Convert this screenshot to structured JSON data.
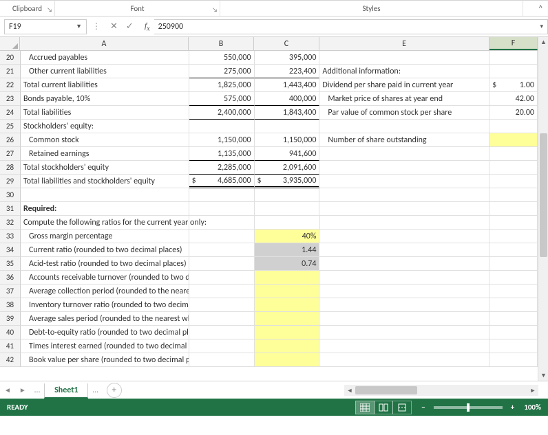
{
  "ribbon": {
    "clipboard": "Clipboard",
    "font": "Font",
    "styles": "Styles"
  },
  "namebox": {
    "ref": "F19"
  },
  "formula_bar": {
    "value": "250900"
  },
  "columns": {
    "A": "A",
    "B": "B",
    "C": "C",
    "E": "E",
    "F": "F"
  },
  "rows": [
    {
      "n": "20",
      "A": "Accrued payables",
      "Ai": 1,
      "B": "550,000",
      "C": "395,000",
      "E": "",
      "F": ""
    },
    {
      "n": "21",
      "A": "Other current liabilities",
      "Ai": 1,
      "B": "275,000",
      "Bu": 1,
      "C": "223,400",
      "Cu": 1,
      "E": "Additional information:",
      "F": ""
    },
    {
      "n": "22",
      "A": "Total current liabilities",
      "B": "1,825,000",
      "C": "1,443,400",
      "E": "Dividend per share paid in current year",
      "F": "1.00",
      "Fd": 1
    },
    {
      "n": "23",
      "A": "Bonds payable, 10%",
      "B": "575,000",
      "Bu": 1,
      "C": "400,000",
      "Cu": 1,
      "E": "Market price of shares at year end",
      "Ei": 1,
      "F": "42.00"
    },
    {
      "n": "24",
      "A": "Total liabilities",
      "B": "2,400,000",
      "Bu": 1,
      "C": "1,843,400",
      "Cu": 1,
      "E": "Par value of common stock per share",
      "Ei": 1,
      "F": "20.00"
    },
    {
      "n": "25",
      "A": "Stockholders' equity:",
      "B": "",
      "C": "",
      "E": "",
      "F": ""
    },
    {
      "n": "26",
      "A": "Common stock",
      "Ai": 1,
      "B": "1,150,000",
      "C": "1,150,000",
      "E": "Number of share outstanding",
      "Ei": 1,
      "F": "",
      "Fy": 1
    },
    {
      "n": "27",
      "A": "Retained earnings",
      "Ai": 1,
      "B": "1,135,000",
      "Bu": 1,
      "C": "941,600",
      "Cu": 1,
      "E": "",
      "F": ""
    },
    {
      "n": "28",
      "A": "Total stockholders' equity",
      "B": "2,285,000",
      "Bu": 1,
      "C": "2,091,600",
      "Cu": 1,
      "E": "",
      "F": ""
    },
    {
      "n": "29",
      "A": "Total liabilities and stockholders' equity",
      "B": "4,685,000",
      "Bd": 1,
      "Bdu": 1,
      "C": "3,935,000",
      "Cd": 1,
      "Cdu": 1,
      "E": "",
      "F": ""
    },
    {
      "n": "30",
      "A": "",
      "B": "",
      "C": "",
      "E": "",
      "F": ""
    },
    {
      "n": "31",
      "A": "Required:",
      "Ab": 1,
      "B": "",
      "C": "",
      "E": "",
      "F": ""
    },
    {
      "n": "32",
      "A": "Compute the following ratios for the current year only:",
      "B": "",
      "C": "",
      "E": "",
      "F": ""
    },
    {
      "n": "33",
      "A": "Gross margin percentage",
      "Ai": 1,
      "B": "",
      "C": "40%",
      "Cy": 1,
      "E": "",
      "F": ""
    },
    {
      "n": "34",
      "A": "Current ratio (rounded to two decimal places)",
      "Ai": 1,
      "B": "",
      "C": "1.44",
      "Cg": 1,
      "E": "",
      "F": ""
    },
    {
      "n": "35",
      "A": "Acid-test ratio (rounded to two decimal places)",
      "Ai": 1,
      "B": "",
      "C": "0.74",
      "Cg": 1,
      "E": "",
      "F": ""
    },
    {
      "n": "36",
      "A": "Accounts receivable turnover (rounded to two decimal places)",
      "Ai": 1,
      "B": "",
      "C": "",
      "Cy": 1,
      "E": "",
      "F": ""
    },
    {
      "n": "37",
      "A": "Average collection period (rounded to the nearest whole day)",
      "Ai": 1,
      "B": "",
      "C": "",
      "Cy": 1,
      "E": "",
      "F": ""
    },
    {
      "n": "38",
      "A": "Inventory turnover ratio (rounded to two decimal places)",
      "Ai": 1,
      "B": "",
      "C": "",
      "Cy": 1,
      "E": "",
      "F": ""
    },
    {
      "n": "39",
      "A": "Average sales period (rounded to the nearest whole day)",
      "Ai": 1,
      "B": "",
      "C": "",
      "Cy": 1,
      "E": "",
      "F": ""
    },
    {
      "n": "40",
      "A": "Debt-to-equity ratio (rounded to two decimal places)",
      "Ai": 1,
      "B": "",
      "C": "",
      "Cy": 1,
      "E": "",
      "F": ""
    },
    {
      "n": "41",
      "A": "Times interest earned (rounded to two decimal places)",
      "Ai": 1,
      "B": "",
      "C": "",
      "Cy": 1,
      "E": "",
      "F": ""
    },
    {
      "n": "42",
      "A": "Book value per share (rounded to two decimal places)",
      "Ai": 1,
      "B": "",
      "C": "",
      "Cy": 1,
      "E": "",
      "F": ""
    }
  ],
  "sheet_tab": {
    "name": "Sheet1"
  },
  "status": {
    "ready": "READY",
    "zoom": "100%"
  }
}
